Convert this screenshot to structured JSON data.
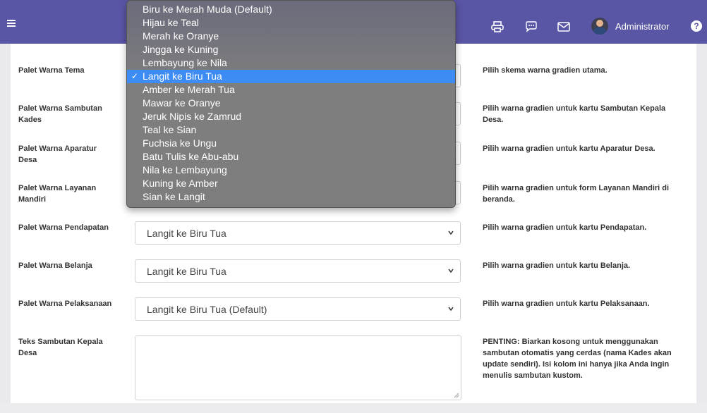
{
  "header": {
    "user_name": "Administrator",
    "help_symbol": "?",
    "icons": [
      "menu-icon",
      "print-icon",
      "chat-icon",
      "mail-icon",
      "avatar",
      "help-icon"
    ]
  },
  "rows": [
    {
      "label": "Palet Warna Tema",
      "help": "Pilih skema warna gradien utama.",
      "value": ""
    },
    {
      "label": "Palet Warna Sambutan Kades",
      "help": "Pilih warna gradien untuk kartu Sambutan Kepala Desa.",
      "value": ""
    },
    {
      "label": "Palet Warna Aparatur Desa",
      "help": "Pilih warna gradien untuk kartu Aparatur Desa.",
      "value": ""
    },
    {
      "label": "Palet Warna Layanan Mandiri",
      "help": "Pilih warna gradien untuk form Layanan Mandiri di beranda.",
      "value": ""
    },
    {
      "label": "Palet Warna Pendapatan",
      "help": "Pilih warna gradien untuk kartu Pendapatan.",
      "value": "Langit ke Biru Tua"
    },
    {
      "label": "Palet Warna Belanja",
      "help": "Pilih warna gradien untuk kartu Belanja.",
      "value": "Langit ke Biru Tua"
    },
    {
      "label": "Palet Warna Pelaksanaan",
      "help": "Pilih warna gradien untuk kartu Pelaksanaan.",
      "value": "Langit ke Biru Tua (Default)"
    }
  ],
  "sambutan": {
    "label": "Teks Sambutan Kepala Desa",
    "help": "PENTING: Biarkan kosong untuk menggunakan sambutan otomatis yang cerdas (nama Kades akan update sendiri). Isi kolom ini hanya jika Anda ingin menulis sambutan kustom.",
    "value": ""
  },
  "dropdown": {
    "selected_index": 5,
    "check_mark": "✓",
    "options": [
      "Biru ke Merah Muda (Default)",
      "Hijau ke Teal",
      "Merah ke Oranye",
      "Jingga ke Kuning",
      "Lembayung ke Nila",
      "Langit ke Biru Tua",
      "Amber ke Merah Tua",
      "Mawar ke Oranye",
      "Jeruk Nipis ke Zamrud",
      "Teal ke Sian",
      "Fuchsia ke Ungu",
      "Batu Tulis ke Abu-abu",
      "Nila ke Lembayung",
      "Kuning ke Amber",
      "Sian ke Langit"
    ]
  },
  "colors": {
    "header": "#5a56a6",
    "selected_option": "#3c8cf4"
  }
}
